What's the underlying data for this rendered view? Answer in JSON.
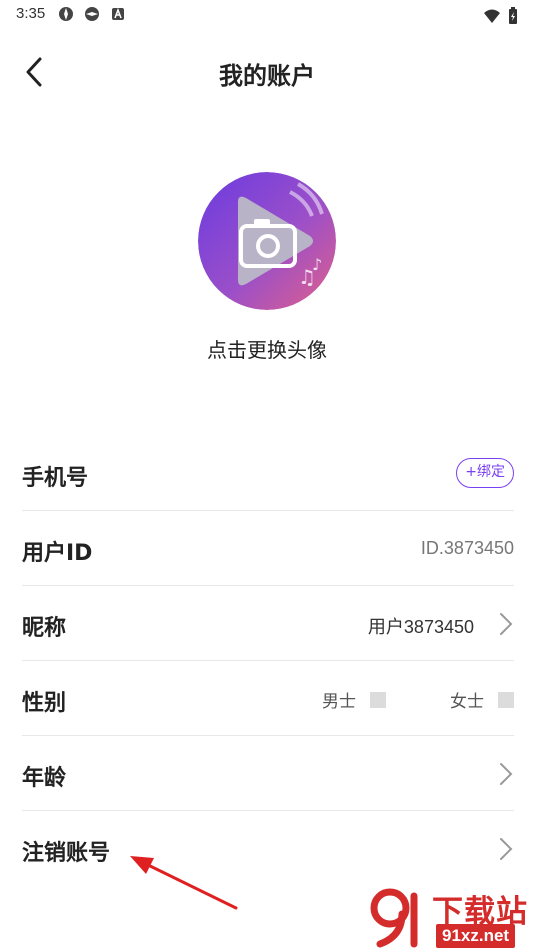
{
  "status_bar": {
    "time": "3:35"
  },
  "header": {
    "title": "我的账户"
  },
  "avatar": {
    "caption": "点击更换头像"
  },
  "rows": {
    "phone": {
      "label": "手机号",
      "bind_label": "+绑定"
    },
    "user_id": {
      "label": "用户ID",
      "value": "ID.3873450"
    },
    "nickname": {
      "label": "昵称",
      "value": "用户3873450"
    },
    "gender": {
      "label": "性别",
      "male": "男士",
      "female": "女士"
    },
    "age": {
      "label": "年龄"
    },
    "cancel_account": {
      "label": "注销账号"
    }
  },
  "watermark": {
    "text": "下载站",
    "url": "91xz.net"
  },
  "colors": {
    "accent": "#7a3ff2",
    "annotation": "#e02020",
    "divider": "#e8e8e8"
  }
}
